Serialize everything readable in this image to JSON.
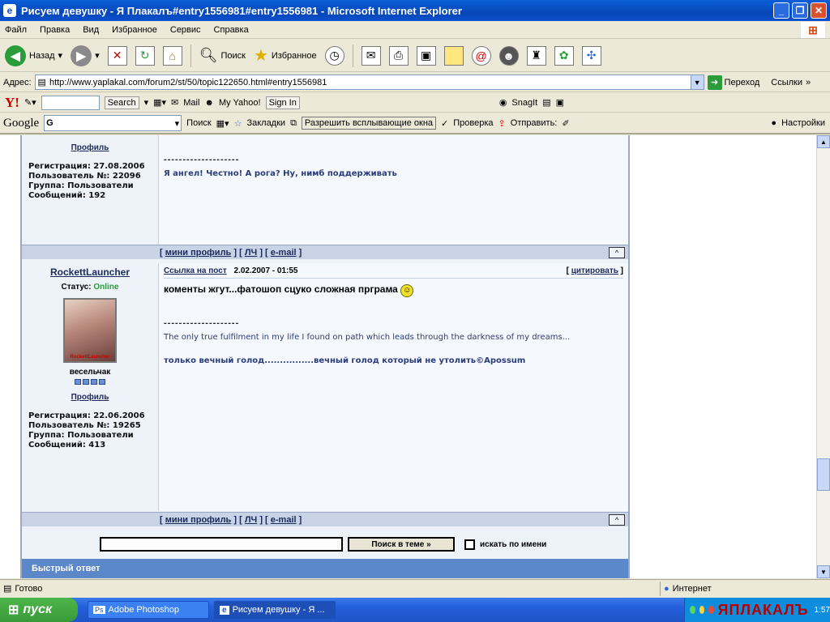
{
  "window": {
    "title": "Рисуем девушку - Я Плакалъ#entry1556981#entry1556981 - Microsoft Internet Explorer"
  },
  "menu": [
    "Файл",
    "Правка",
    "Вид",
    "Избранное",
    "Сервис",
    "Справка"
  ],
  "toolbar": {
    "back": "Назад",
    "search": "Поиск",
    "favorites": "Избранное"
  },
  "address": {
    "label": "Адрес:",
    "url": "http://www.yaplakal.com/forum2/st/50/topic122650.html#entry1556981",
    "go": "Переход",
    "links": "Ссылки"
  },
  "yahoo": {
    "search_btn": "Search",
    "mail": "Mail",
    "my_yahoo": "My Yahoo!",
    "sign_in": "Sign In",
    "snagit": "SnagIt"
  },
  "google": {
    "logo": "Google",
    "input_prefix": "G",
    "search": "Поиск",
    "bookmarks": "Закладки",
    "popups": "Разрешить всплывающие окна",
    "check": "Проверка",
    "send": "Отправить:",
    "settings": "Настройки"
  },
  "post1": {
    "profile_link": "Профиль",
    "reg": "Регистрация: 27.08.2006",
    "user_no": "Пользователь №: 22096",
    "group": "Группа: Пользователи",
    "messages": "Сообщений: 192",
    "dashes": "--------------------",
    "text": "Я ангел! Честно! А рога? Ну, нимб поддерживать"
  },
  "footer_links": {
    "mini_profile": "мини профиль",
    "pm": "ЛЧ",
    "email": "e-mail",
    "up": "^"
  },
  "post2": {
    "author": "RockettLauncher",
    "status_label": "Статус:",
    "status_value": "Online",
    "avatar_caption": "RockettLauncher",
    "rank": "весельчак",
    "profile_link": "Профиль",
    "reg": "Регистрация: 22.06.2006",
    "user_no": "Пользователь №: 19265",
    "group": "Группа: Пользователи",
    "messages": "Сообщений: 413",
    "post_link": "Ссылка на пост",
    "date": "2.02.2007 - 01:55",
    "quote": "цитировать",
    "text": "коменты жгут...фатошоп сцуко сложная прграма",
    "dashes": "--------------------",
    "sig1": "The only true fulfilment in my life I found on path which leads through the darkness of my dreams...",
    "sig2": "только вечный голод................вечный голод который не утолить©Apossum"
  },
  "search": {
    "button": "Поиск в теме »",
    "checkbox_label": "искать по имени"
  },
  "quick_reply": "Быстрый ответ",
  "status": {
    "ready": "Готово",
    "zone": "Интернет"
  },
  "taskbar": {
    "start": "пуск",
    "items": [
      "Adobe Photoshop",
      "Рисуем девушку - Я ..."
    ],
    "watermark": "ЯПЛАКАЛЪ",
    "clock": "1:57"
  }
}
